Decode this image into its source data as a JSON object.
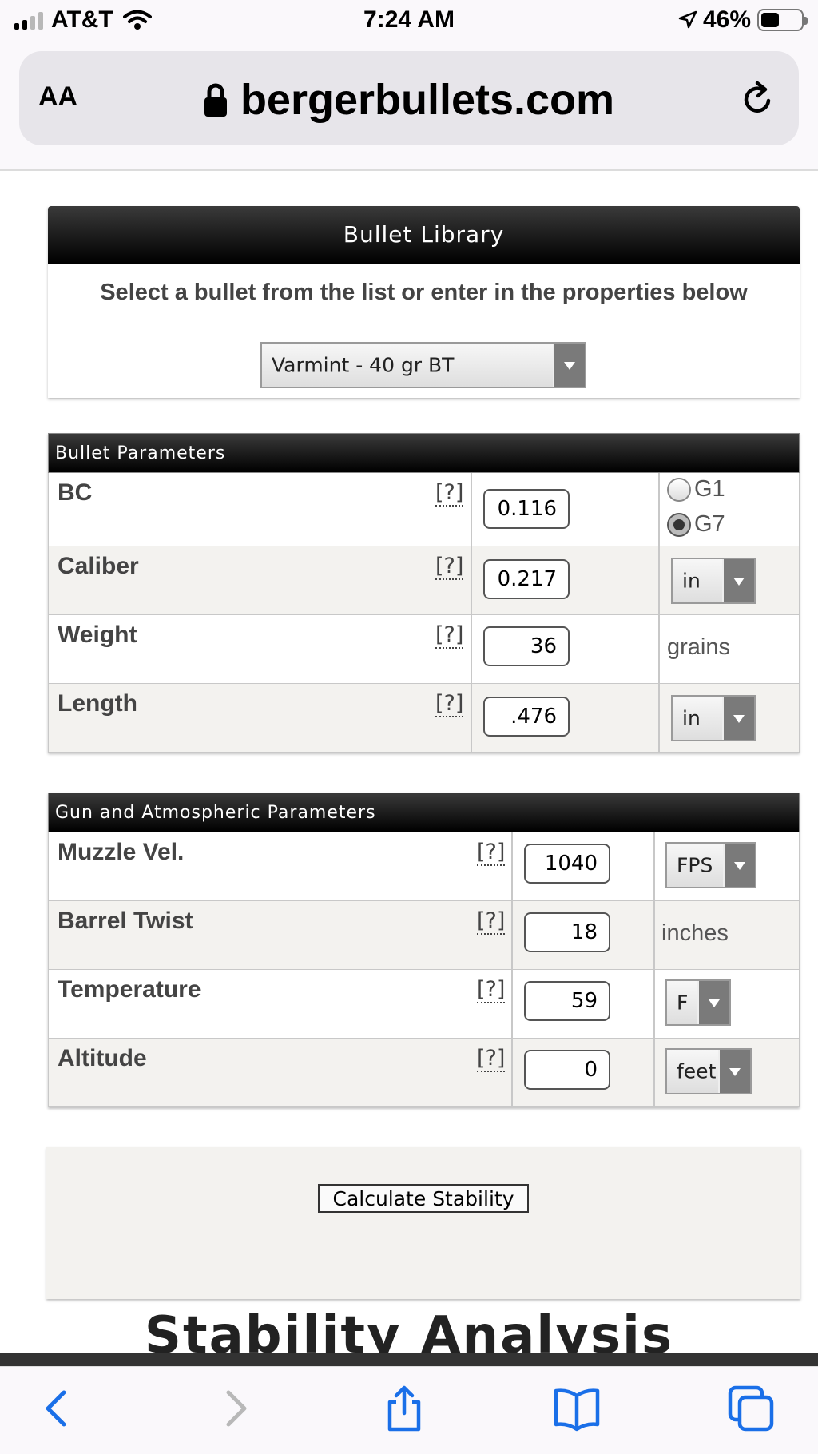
{
  "status": {
    "carrier": "AT&T",
    "time": "7:24 AM",
    "battery": "46%"
  },
  "browser": {
    "text_size_label": "AA",
    "domain": "bergerbullets.com"
  },
  "library": {
    "title": "Bullet Library",
    "instructions": "Select a bullet from the list or enter in the properties below",
    "selected_bullet": "Varmint - 40 gr BT"
  },
  "bullet_params": {
    "title": "Bullet Parameters",
    "help": "[?]",
    "bc": {
      "label": "BC",
      "value": "0.116",
      "options": [
        "G1",
        "G7"
      ],
      "selected": "G7"
    },
    "caliber": {
      "label": "Caliber",
      "value": "0.217",
      "unit": "in"
    },
    "weight": {
      "label": "Weight",
      "value": "36",
      "unit": "grains"
    },
    "length": {
      "label": "Length",
      "value": ".476",
      "unit": "in"
    }
  },
  "gun_params": {
    "title": "Gun and Atmospheric Parameters",
    "help": "[?]",
    "muzzle": {
      "label": "Muzzle Vel.",
      "value": "1040",
      "unit": "FPS"
    },
    "twist": {
      "label": "Barrel Twist",
      "value": "18",
      "unit": "inches"
    },
    "temp": {
      "label": "Temperature",
      "value": "59",
      "unit": "F"
    },
    "altitude": {
      "label": "Altitude",
      "value": "0",
      "unit": "feet"
    }
  },
  "actions": {
    "calculate": "Calculate Stability"
  },
  "section_heading": "Stability Analysis",
  "toolbar": {
    "icons": [
      "back-icon",
      "forward-icon",
      "share-icon",
      "bookmarks-icon",
      "tabs-icon"
    ]
  }
}
